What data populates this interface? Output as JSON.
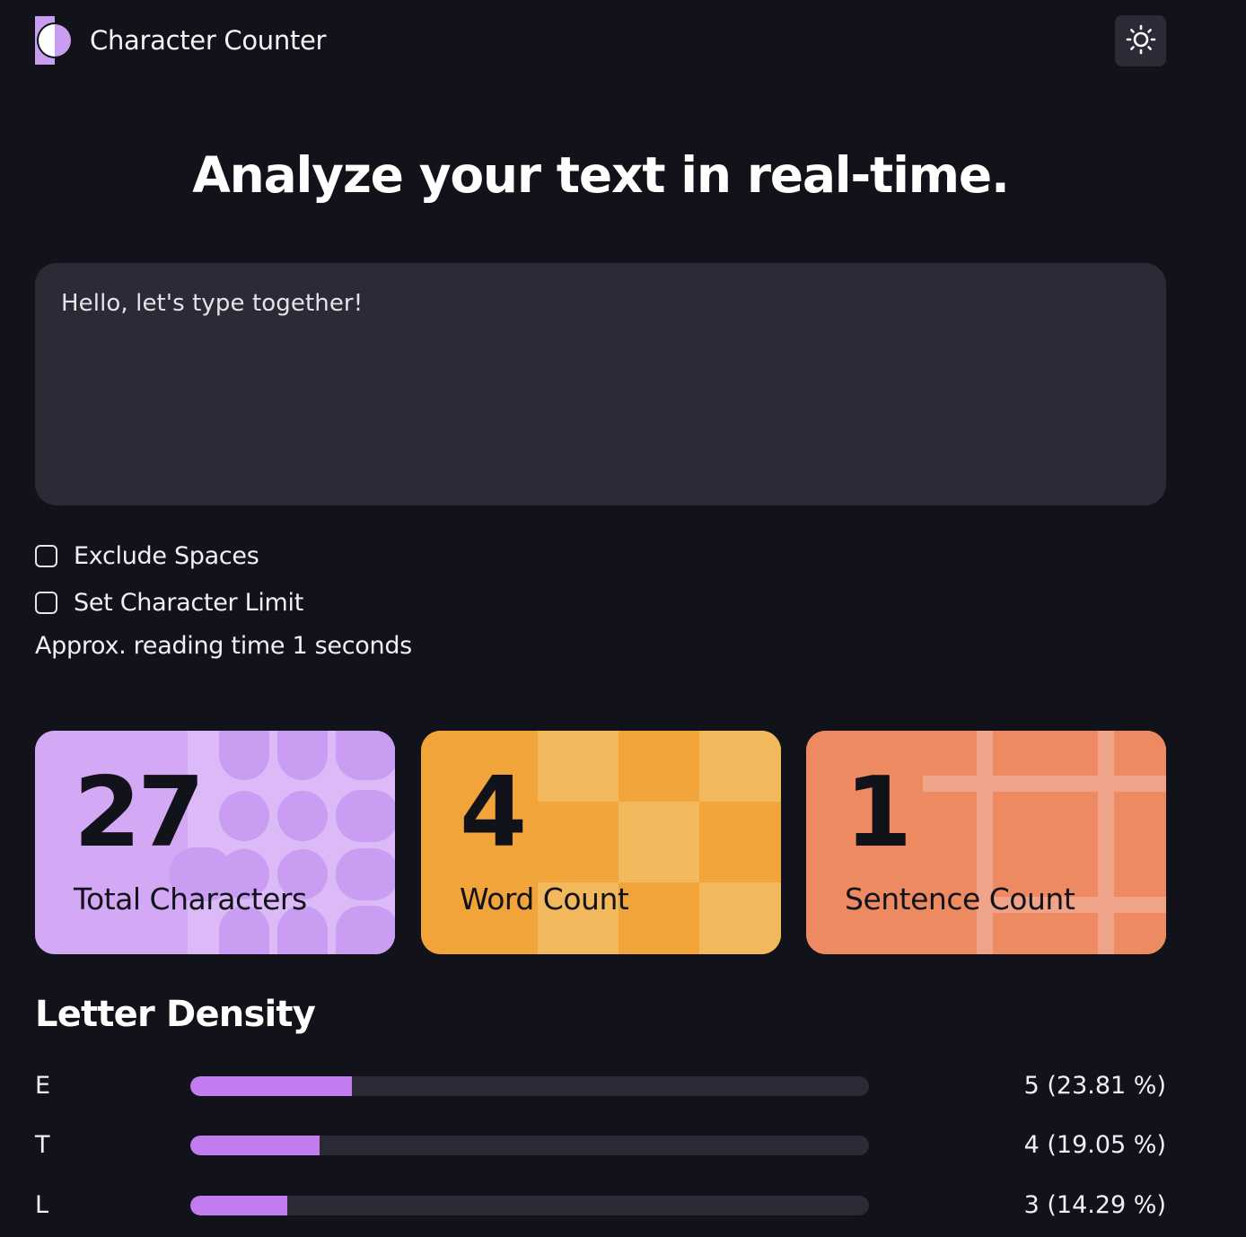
{
  "header": {
    "app_title": "Character Counter",
    "logo_icon": "half-circle-logo-icon",
    "theme_toggle_icon": "sun-icon"
  },
  "hero": {
    "title": "Analyze your text in real-time."
  },
  "editor": {
    "value": "Hello, let's type together!"
  },
  "options": {
    "exclude_spaces": {
      "label": "Exclude Spaces",
      "checked": false
    },
    "character_limit": {
      "label": "Set Character Limit",
      "checked": false
    },
    "reading_time": "Approx. reading time 1 seconds"
  },
  "stats": {
    "total_characters": {
      "value": "27",
      "label": "Total Characters",
      "color": "#d3a8f5"
    },
    "word_count": {
      "value": "4",
      "label": "Word Count",
      "color": "#f1a43a"
    },
    "sentence_count": {
      "value": "1",
      "label": "Sentence Count",
      "color": "#ee8a62"
    }
  },
  "density": {
    "title": "Letter Density",
    "accent": "#c27cf0",
    "rows": [
      {
        "letter": "E",
        "value": "5 (23.81 %)",
        "fraction": 0.2381
      },
      {
        "letter": "T",
        "value": "4 (19.05 %)",
        "fraction": 0.1905
      },
      {
        "letter": "L",
        "value": "3 (14.29 %)",
        "fraction": 0.1429
      }
    ]
  }
}
